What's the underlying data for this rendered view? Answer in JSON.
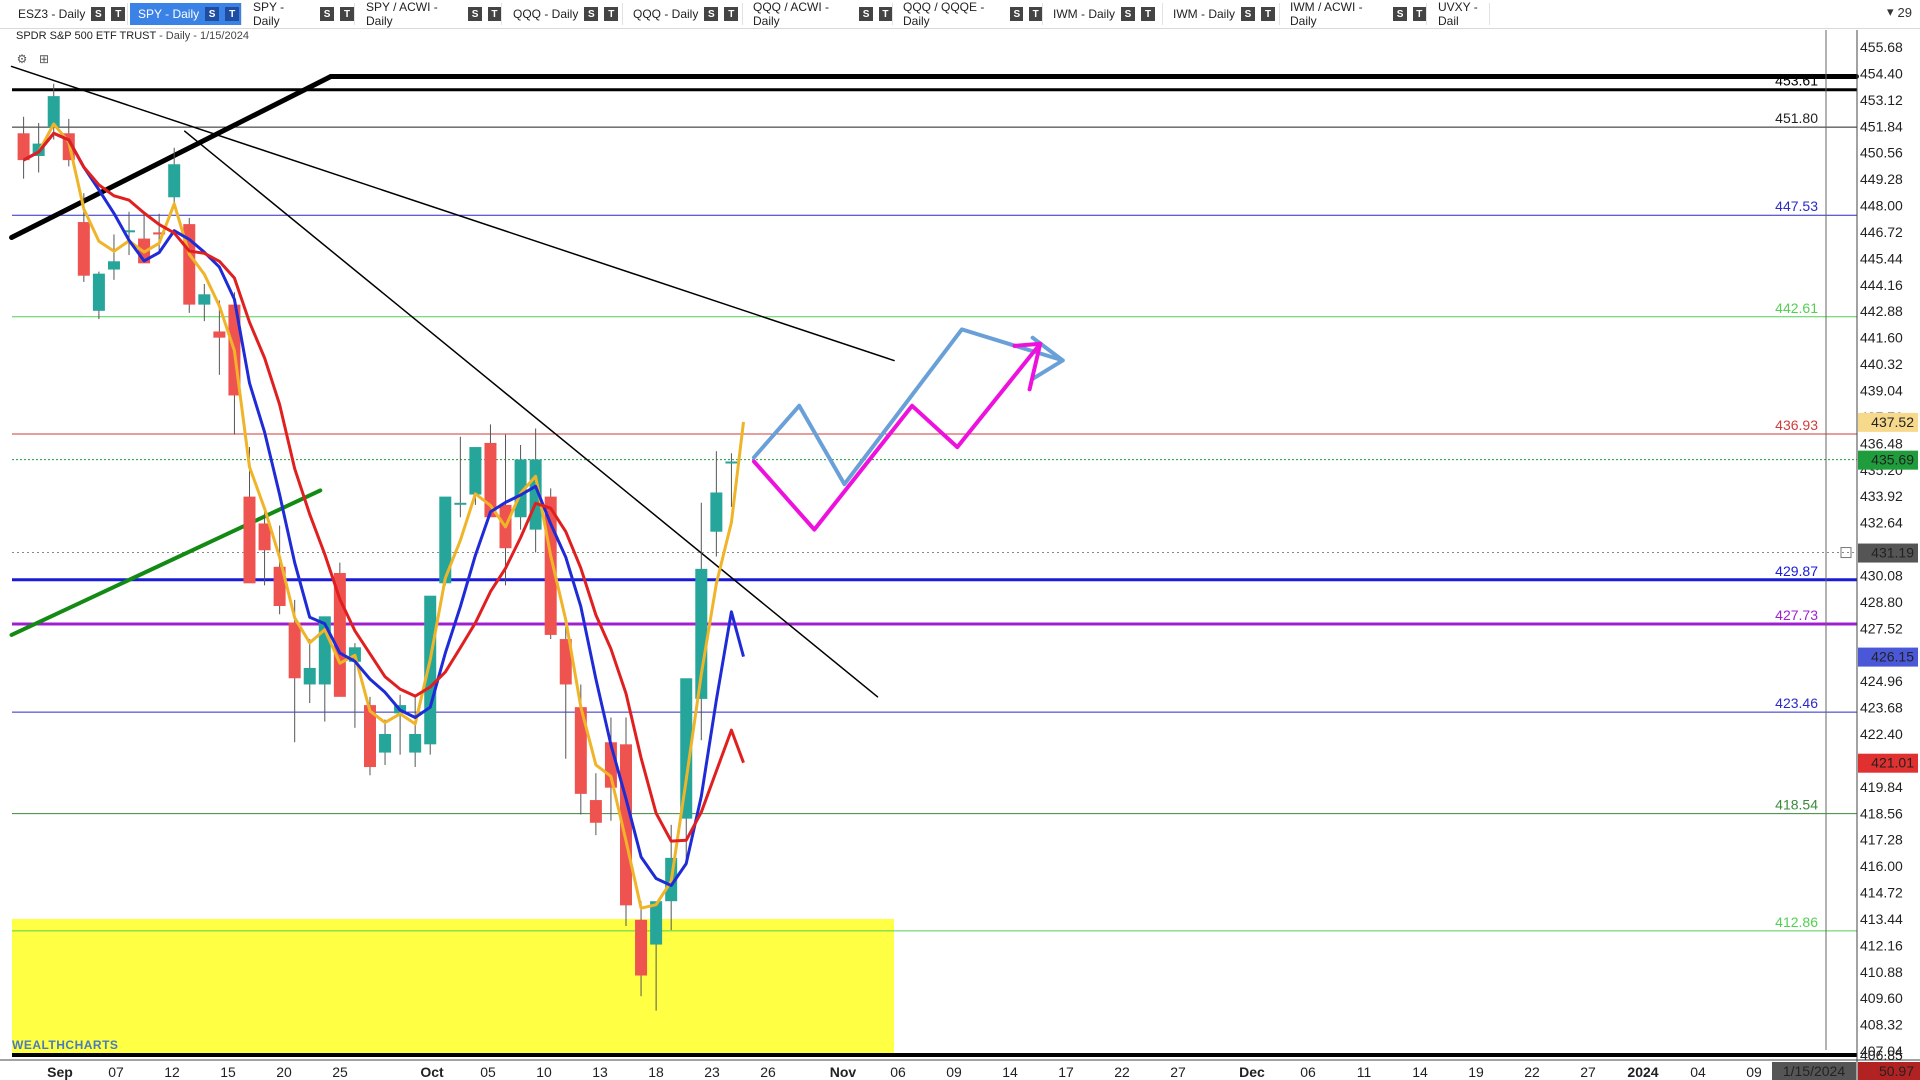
{
  "tabs": [
    {
      "label": "ESZ3 - Daily",
      "active": false
    },
    {
      "label": "SPY - Daily",
      "active": true
    },
    {
      "label": "SPY - Daily",
      "active": false
    },
    {
      "label": "SPY / ACWI - Daily",
      "active": false
    },
    {
      "label": "QQQ - Daily",
      "active": false
    },
    {
      "label": "QQQ - Daily",
      "active": false
    },
    {
      "label": "QQQ / ACWI - Daily",
      "active": false
    },
    {
      "label": "QQQ / QQQE - Daily",
      "active": false
    },
    {
      "label": "IWM - Daily",
      "active": false
    },
    {
      "label": "IWM - Daily",
      "active": false
    },
    {
      "label": "IWM / ACWI - Daily",
      "active": false
    },
    {
      "label": "UVXY - Dail",
      "active": false
    }
  ],
  "tab_buttons": [
    "S",
    "T"
  ],
  "tab_overflow": {
    "icon": "chevron-down-icon",
    "count": "29"
  },
  "chart": {
    "name": "SPDR S&P 500 ETF TRUST",
    "interval": "- Daily - 1/15/2024",
    "logo": "WEALTHCHARTS"
  },
  "chart_data": {
    "type": "candlestick",
    "y_axis": {
      "min": 406.85,
      "max": 455.68
    },
    "price_ticks": [
      "455.68",
      "454.40",
      "453.12",
      "451.84",
      "450.56",
      "449.28",
      "448.00",
      "446.72",
      "445.44",
      "444.16",
      "442.88",
      "441.60",
      "440.32",
      "439.04",
      "437.76",
      "436.48",
      "435.20",
      "433.92",
      "432.64",
      "431.36",
      "430.08",
      "428.80",
      "427.52",
      "426.24",
      "424.96",
      "423.68",
      "422.40",
      "421.12",
      "419.84",
      "418.56",
      "417.28",
      "416.00",
      "414.72",
      "413.44",
      "412.16",
      "410.88",
      "409.60",
      "408.32",
      "407.04",
      "406.85"
    ],
    "date_ticks": [
      {
        "label": "Sep",
        "bold": true
      },
      {
        "label": "07",
        "bold": false
      },
      {
        "label": "12",
        "bold": false
      },
      {
        "label": "15",
        "bold": false
      },
      {
        "label": "20",
        "bold": false
      },
      {
        "label": "25",
        "bold": false
      },
      {
        "label": "Oct",
        "bold": true
      },
      {
        "label": "05",
        "bold": false
      },
      {
        "label": "10",
        "bold": false
      },
      {
        "label": "13",
        "bold": false
      },
      {
        "label": "18",
        "bold": false
      },
      {
        "label": "23",
        "bold": false
      },
      {
        "label": "26",
        "bold": false
      },
      {
        "label": "Nov",
        "bold": true
      },
      {
        "label": "06",
        "bold": false
      },
      {
        "label": "09",
        "bold": false
      },
      {
        "label": "14",
        "bold": false
      },
      {
        "label": "17",
        "bold": false
      },
      {
        "label": "22",
        "bold": false
      },
      {
        "label": "27",
        "bold": false
      },
      {
        "label": "Dec",
        "bold": true
      },
      {
        "label": "06",
        "bold": false
      },
      {
        "label": "11",
        "bold": false
      },
      {
        "label": "14",
        "bold": false
      },
      {
        "label": "19",
        "bold": false
      },
      {
        "label": "22",
        "bold": false
      },
      {
        "label": "27",
        "bold": false
      },
      {
        "label": "2024",
        "bold": true
      },
      {
        "label": "04",
        "bold": false
      },
      {
        "label": "09",
        "bold": false
      }
    ],
    "candles": [
      [
        451.5,
        452.3,
        449.3,
        450.2
      ],
      [
        450.4,
        452.0,
        449.6,
        451.0
      ],
      [
        451.8,
        453.9,
        451.2,
        453.3
      ],
      [
        451.5,
        452.2,
        449.9,
        450.2
      ],
      [
        447.2,
        448.6,
        444.3,
        444.6
      ],
      [
        442.9,
        444.8,
        442.5,
        444.7
      ],
      [
        444.9,
        446.6,
        444.4,
        445.3
      ],
      [
        446.8,
        447.7,
        445.6,
        446.8
      ],
      [
        446.4,
        447.7,
        445.4,
        445.2
      ],
      [
        446.7,
        447.6,
        445.7,
        446.6
      ],
      [
        448.4,
        450.8,
        448.0,
        450.0
      ],
      [
        447.1,
        447.4,
        442.8,
        443.2
      ],
      [
        443.2,
        444.2,
        442.4,
        443.7
      ],
      [
        441.9,
        443.4,
        439.8,
        441.6
      ],
      [
        443.2,
        443.8,
        436.9,
        438.8
      ],
      [
        433.9,
        436.3,
        430.3,
        429.7
      ],
      [
        432.6,
        433.2,
        429.6,
        431.3
      ],
      [
        430.5,
        432.5,
        428.2,
        428.6
      ],
      [
        427.8,
        428.9,
        422.0,
        425.1
      ],
      [
        424.8,
        427.0,
        423.9,
        425.6
      ],
      [
        424.8,
        427.9,
        423.0,
        428.1
      ],
      [
        430.2,
        430.7,
        424.9,
        424.2
      ],
      [
        425.9,
        426.8,
        422.7,
        426.6
      ],
      [
        423.8,
        424.2,
        420.4,
        420.8
      ],
      [
        421.5,
        423.1,
        420.9,
        422.4
      ],
      [
        423.4,
        424.3,
        421.4,
        423.8
      ],
      [
        421.5,
        424.3,
        420.8,
        422.4
      ],
      [
        421.9,
        429.0,
        421.4,
        429.1
      ],
      [
        429.7,
        432.9,
        429.6,
        433.9
      ],
      [
        433.6,
        436.8,
        432.9,
        433.6
      ],
      [
        434.0,
        436.1,
        433.5,
        436.3
      ],
      [
        436.5,
        437.4,
        434.8,
        432.9
      ],
      [
        433.5,
        436.9,
        429.6,
        431.4
      ],
      [
        432.9,
        436.4,
        432.3,
        435.7
      ],
      [
        432.3,
        437.2,
        431.2,
        435.7
      ],
      [
        433.9,
        434.3,
        427.0,
        427.2
      ],
      [
        427.0,
        427.6,
        421.2,
        424.8
      ],
      [
        423.7,
        424.8,
        418.5,
        419.5
      ],
      [
        419.2,
        420.5,
        417.5,
        418.1
      ],
      [
        422.0,
        423.2,
        418.2,
        419.8
      ],
      [
        421.9,
        423.2,
        413.1,
        414.1
      ],
      [
        413.4,
        414.3,
        409.7,
        410.7
      ],
      [
        412.2,
        414.1,
        409.0,
        414.3
      ],
      [
        414.3,
        418.0,
        412.9,
        416.4
      ],
      [
        418.3,
        420.9,
        416.3,
        425.1
      ],
      [
        424.1,
        433.6,
        422.1,
        430.4
      ],
      [
        432.2,
        436.1,
        431.0,
        434.1
      ],
      [
        435.6,
        436.0,
        433.4,
        435.6
      ]
    ],
    "indicators": [
      {
        "name": "Fast EMA",
        "color": "#f0b429",
        "last": "437.52"
      },
      {
        "name": "Medium MA",
        "color": "#1f2bd6",
        "last": "426.15"
      },
      {
        "name": "Slow MA",
        "color": "#e02020",
        "last": "421.01"
      }
    ],
    "levels": [
      {
        "value": "453.61",
        "color": "#000000",
        "width": 3
      },
      {
        "value": "451.80",
        "color": "#222222",
        "width": 1
      },
      {
        "value": "447.53",
        "color": "#2a2ac8",
        "width": 1
      },
      {
        "value": "442.61",
        "color": "#52d052",
        "width": 1
      },
      {
        "value": "436.93",
        "color": "#d23b3b",
        "width": 1
      },
      {
        "value": "429.87",
        "color": "#1a1ad8",
        "width": 3
      },
      {
        "value": "427.73",
        "color": "#a020d0",
        "width": 3
      },
      {
        "value": "423.46",
        "color": "#2a2ac8",
        "width": 1
      },
      {
        "value": "418.54",
        "color": "#3a8a3a",
        "width": 1
      },
      {
        "value": "412.86",
        "color": "#52d052",
        "width": 1
      },
      {
        "value": "406.85",
        "color": "#000000",
        "width": 4
      }
    ],
    "price_badges": [
      {
        "value": "437.52",
        "bg": "#f7d98c",
        "fg": "#222222"
      },
      {
        "value": "435.69",
        "bg": "#1f9c3b",
        "fg": "#ffffff"
      },
      {
        "value": "431.19",
        "bg": "#555555",
        "fg": "#ffffff"
      },
      {
        "value": "426.15",
        "bg": "#4a58d8",
        "fg": "#ffffff"
      },
      {
        "value": "421.01",
        "bg": "#e03030",
        "fg": "#ffffff"
      }
    ],
    "crosshair_date": "1/15/2024",
    "corner_value": "50.97",
    "colors": {
      "up": "#26a69a",
      "down": "#ef5350",
      "zone": "#ffff44",
      "projection_blue": "#6aa0d8",
      "projection_magenta": "#ee11dd",
      "trend_green": "#138a13"
    }
  }
}
